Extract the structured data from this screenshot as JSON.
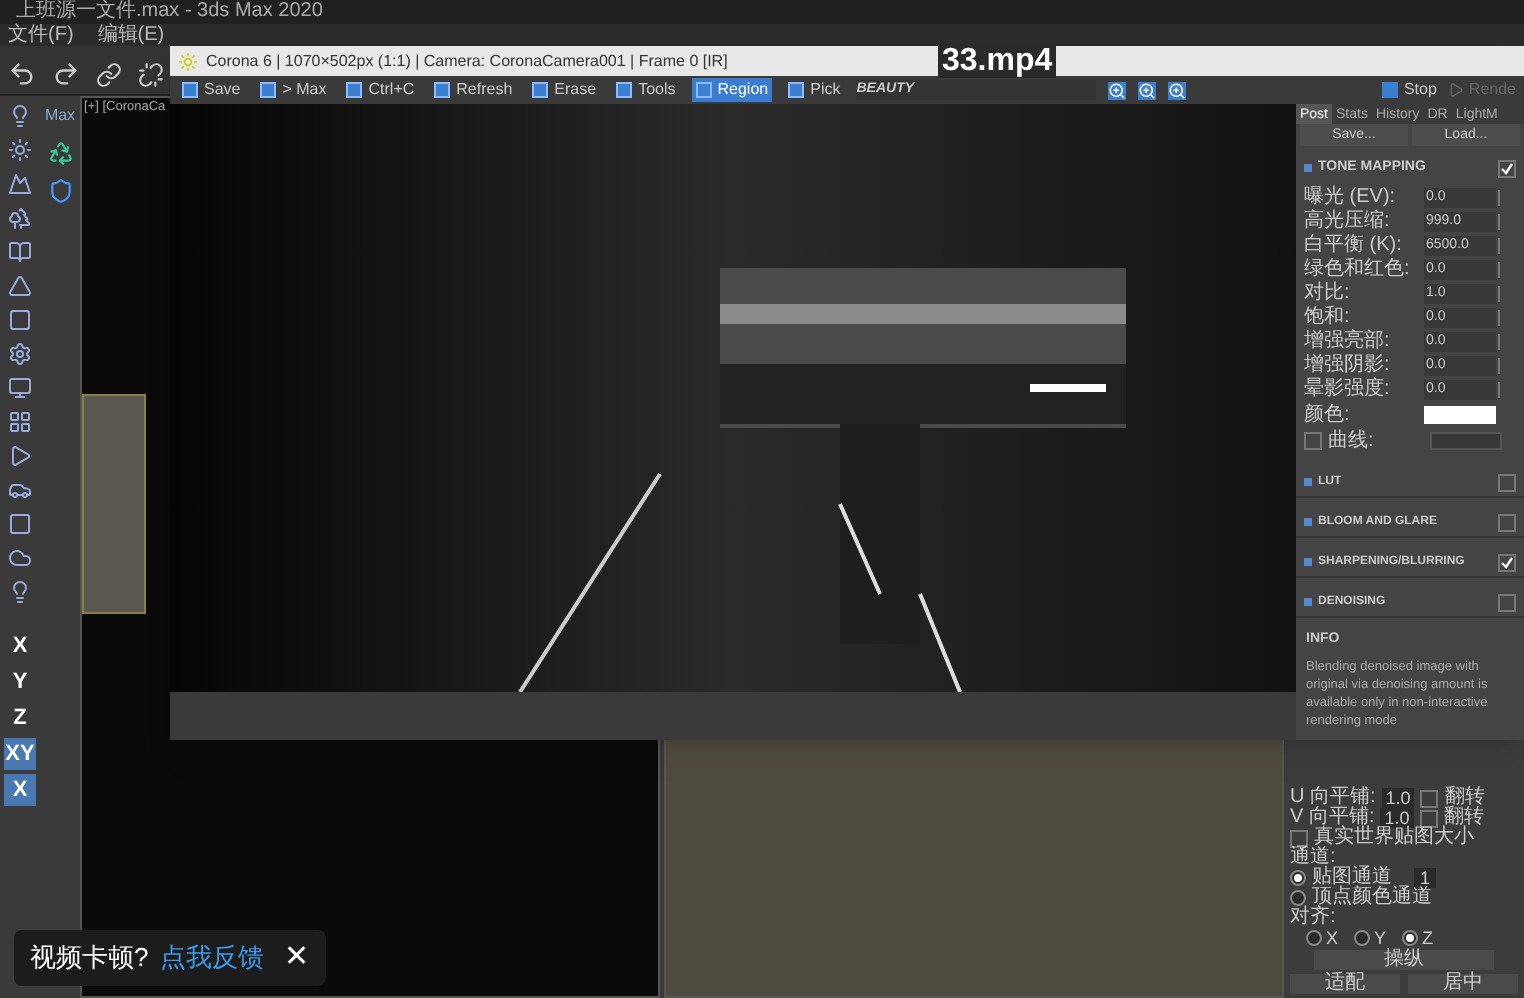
{
  "max_window": {
    "title": "上班源一文件.max - 3ds Max 2020",
    "menu": [
      "文件(F)",
      "编辑(E)"
    ],
    "side_label": "Max",
    "viewport_label": "[+] [CoronaCa",
    "axis_buttons": [
      {
        "label": "X",
        "selected": false
      },
      {
        "label": "Y",
        "selected": false
      },
      {
        "label": "Z",
        "selected": false
      },
      {
        "label": "XY",
        "selected": true
      },
      {
        "label": "X",
        "selected": true
      }
    ]
  },
  "video_title": "33.mp4",
  "corona_window": {
    "title": "Corona 6 | 1070×502px (1:1) | Camera: CoronaCamera001 | Frame 0 [IR]",
    "toolbar": [
      {
        "label": "Save",
        "selected": false
      },
      {
        "label": "> Max",
        "selected": false
      },
      {
        "label": "Ctrl+C",
        "selected": false
      },
      {
        "label": "Refresh",
        "selected": false
      },
      {
        "label": "Erase",
        "selected": false
      },
      {
        "label": "Tools",
        "selected": false
      },
      {
        "label": "Region",
        "selected": true
      },
      {
        "label": "Pick",
        "selected": false
      }
    ],
    "render_pass": "BEAUTY",
    "stop": "Stop",
    "render": "Rende",
    "tabs": [
      {
        "label": "Post",
        "selected": true
      },
      {
        "label": "Stats",
        "selected": false
      },
      {
        "label": "History",
        "selected": false
      },
      {
        "label": "DR",
        "selected": false
      },
      {
        "label": "LightM",
        "selected": false
      }
    ],
    "preset_buttons": [
      "Save...",
      "Load..."
    ],
    "tone_mapping": {
      "title": "TONE MAPPING",
      "checked": true,
      "params": [
        {
          "label": "曝光 (EV):",
          "value": "0.0"
        },
        {
          "label": "高光压缩:",
          "value": "999.0"
        },
        {
          "label": "白平衡 (K):",
          "value": "6500.0"
        },
        {
          "label": "绿色和红色:",
          "value": "0.0"
        },
        {
          "label": "对比:",
          "value": "1.0"
        },
        {
          "label": "饱和:",
          "value": "0.0"
        },
        {
          "label": "增强亮部:",
          "value": "0.0"
        },
        {
          "label": "增强阴影:",
          "value": "0.0"
        },
        {
          "label": "晕影强度:",
          "value": "0.0"
        }
      ],
      "color_label": "颜色:",
      "color": "#ffffff",
      "curve_label": "曲线:",
      "curve_checked": false
    },
    "sections": [
      {
        "title": "LUT",
        "checked": false
      },
      {
        "title": "BLOOM AND GLARE",
        "checked": false
      },
      {
        "title": "SHARPENING/BLURRING",
        "checked": true
      },
      {
        "title": "DENOISING",
        "checked": false
      }
    ],
    "info": {
      "title": "INFO",
      "text": "Blending denoised image with original via denoising amount is available only in non-interactive rendering mode"
    }
  },
  "command_panel": {
    "tiling": [
      {
        "label": "U 向平铺:",
        "value": "1.0",
        "flip": "翻转",
        "checked": false
      },
      {
        "label": "V 向平铺:",
        "value": "1.0",
        "flip": "翻转",
        "checked": false
      }
    ],
    "real_world": {
      "label": "真实世界贴图大小",
      "checked": false
    },
    "channel_title": "通道:",
    "channels": [
      {
        "label": "贴图通道",
        "selected": true,
        "value": "1"
      },
      {
        "label": "顶点颜色通道",
        "selected": false
      }
    ],
    "align_title": "对齐:",
    "axes": [
      {
        "label": "X",
        "selected": false
      },
      {
        "label": "Y",
        "selected": false
      },
      {
        "label": "Z",
        "selected": true
      }
    ],
    "buttons": [
      "操纵",
      "适配",
      "居中"
    ]
  },
  "toast": {
    "text": "视频卡顿?",
    "link": "点我反馈",
    "close": "✕"
  }
}
